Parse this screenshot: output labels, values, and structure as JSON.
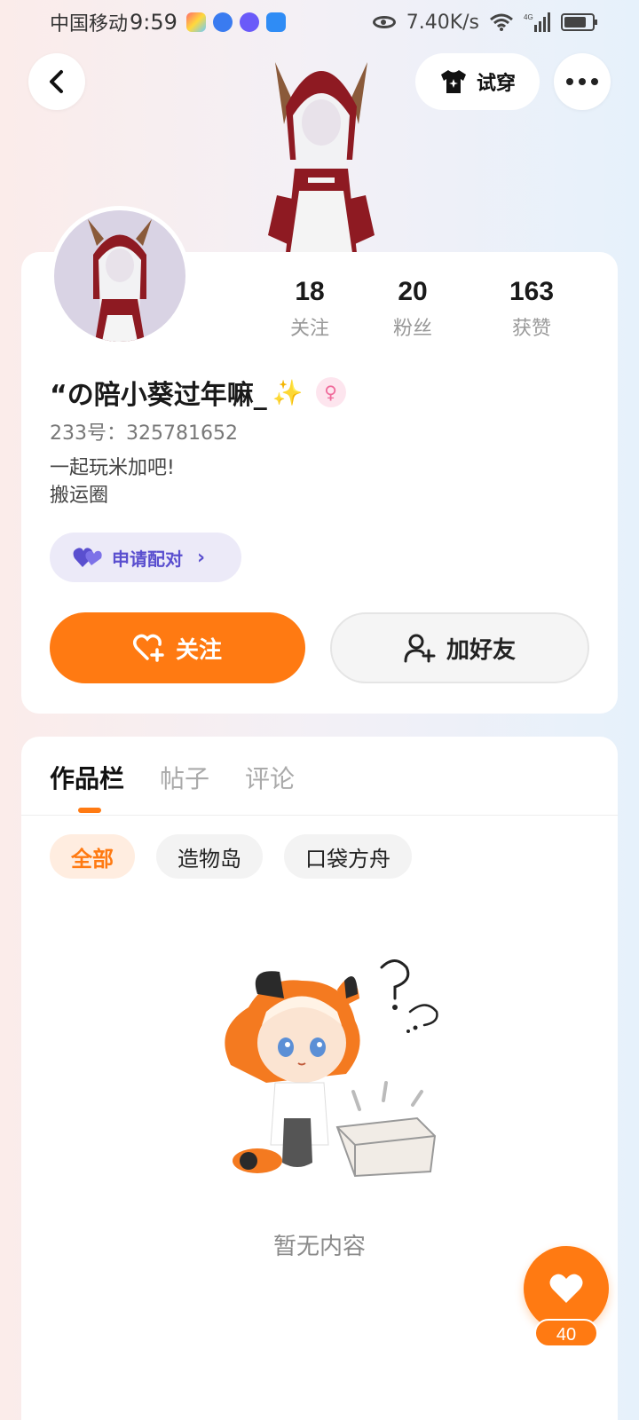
{
  "status_bar": {
    "carrier": "中国移动",
    "time": "9:59",
    "network_speed": "7.40K/s",
    "signal_type": "4G"
  },
  "header": {
    "try_on_label": "试穿"
  },
  "profile": {
    "stats": [
      {
        "value": "18",
        "label": "关注"
      },
      {
        "value": "20",
        "label": "粉丝"
      },
      {
        "value": "163",
        "label": "获赞"
      }
    ],
    "username": "“の陪小葵过年嘛_",
    "username_emoji": "✨",
    "gender_symbol": "♀",
    "uid": "233号：325781652",
    "bio_line1": "一起玩米加吧!",
    "bio_line2": "搬运圈",
    "pair_label": "申请配对",
    "follow_label": "关注",
    "add_friend_label": "加好友"
  },
  "content": {
    "tabs": [
      "作品栏",
      "帖子",
      "评论"
    ],
    "active_tab": 0,
    "chips": [
      "全部",
      "造物岛",
      "口袋方舟"
    ],
    "active_chip": 0,
    "empty_text": "暂无内容"
  },
  "like_fab": {
    "count": "40"
  },
  "colors": {
    "accent": "#ff7a12",
    "pair_purple": "#5a4fcf",
    "female_pink": "#f06a9b"
  }
}
